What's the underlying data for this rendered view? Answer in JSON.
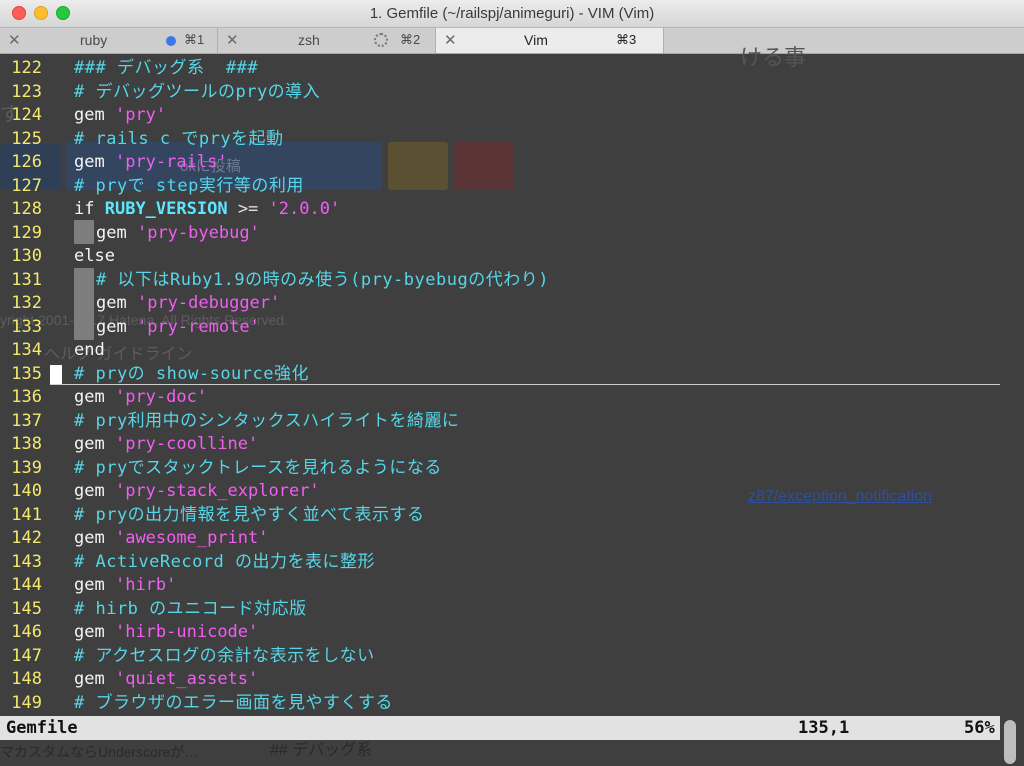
{
  "window": {
    "title": "1. Gemfile (~/railspj/animeguri) - VIM (Vim)"
  },
  "tabs": [
    {
      "label": "ruby",
      "shortcut": "⌘1"
    },
    {
      "label": "zsh",
      "shortcut": "⌘2"
    },
    {
      "label": "Vim",
      "shortcut": "⌘3"
    }
  ],
  "background_page": {
    "button_text": "okに投稿",
    "copyright": "yright 2001-2017 Hatena. All Rights Reserved.",
    "help_links": "ヘルプ  ガイドライン",
    "link_text": "z87/exception_notification",
    "side_text": "ける事",
    "bottom_left": "マカスタムならUnderscoreが…",
    "bottom_heading": "## デバッグ系",
    "fragment": "す"
  },
  "editor": {
    "lines": [
      {
        "num": "122",
        "text": "### デバッグ系  ###"
      },
      {
        "num": "123",
        "text": "# デバッグツールのpryの導入"
      },
      {
        "num": "124",
        "kw": "gem",
        "str": "'pry'"
      },
      {
        "num": "125",
        "text": "# rails c でpryを起動"
      },
      {
        "num": "126",
        "kw": "gem",
        "str": "'pry-rails'"
      },
      {
        "num": "127",
        "text": "# pryで step実行等の利用"
      },
      {
        "num": "128",
        "kw": "if",
        "const": "RUBY_VERSION",
        "op": ">=",
        "str": "'2.0.0'"
      },
      {
        "num": "129",
        "kw": "gem",
        "str": "'pry-byebug'"
      },
      {
        "num": "130",
        "kw": "else"
      },
      {
        "num": "131",
        "text": "# 以下はRuby1.9の時のみ使う(pry-byebugの代わり)"
      },
      {
        "num": "132",
        "kw": "gem",
        "str": "'pry-debugger'"
      },
      {
        "num": "133",
        "kw": "gem",
        "str": "'pry-remote'"
      },
      {
        "num": "134",
        "kw": "end"
      },
      {
        "num": "135",
        "text": "# pryの show-source強化"
      },
      {
        "num": "136",
        "kw": "gem",
        "str": "'pry-doc'"
      },
      {
        "num": "137",
        "text": "# pry利用中のシンタックスハイライトを綺麗に"
      },
      {
        "num": "138",
        "kw": "gem",
        "str": "'pry-coolline'"
      },
      {
        "num": "139",
        "text": "# pryでスタックトレースを見れるようになる"
      },
      {
        "num": "140",
        "kw": "gem",
        "str": "'pry-stack_explorer'"
      },
      {
        "num": "141",
        "text": "# pryの出力情報を見やすく並べて表示する"
      },
      {
        "num": "142",
        "kw": "gem",
        "str": "'awesome_print'"
      },
      {
        "num": "143",
        "text": "# ActiveRecord の出力を表に整形"
      },
      {
        "num": "144",
        "kw": "gem",
        "str": "'hirb'"
      },
      {
        "num": "145",
        "text": "# hirb のユニコード対応版"
      },
      {
        "num": "146",
        "kw": "gem",
        "str": "'hirb-unicode'"
      },
      {
        "num": "147",
        "text": "# アクセスログの余計な表示をしない"
      },
      {
        "num": "148",
        "kw": "gem",
        "str": "'quiet_assets'"
      },
      {
        "num": "149",
        "text": "# ブラウザのエラー画面を見やすくする"
      }
    ]
  },
  "status": {
    "filename": "Gemfile",
    "position": "135,1",
    "percent": "56%"
  },
  "colors": {
    "line_number": "#f4e96c",
    "comment": "#56d6e8",
    "string": "#f25df2",
    "background": "#3f3f3f"
  }
}
